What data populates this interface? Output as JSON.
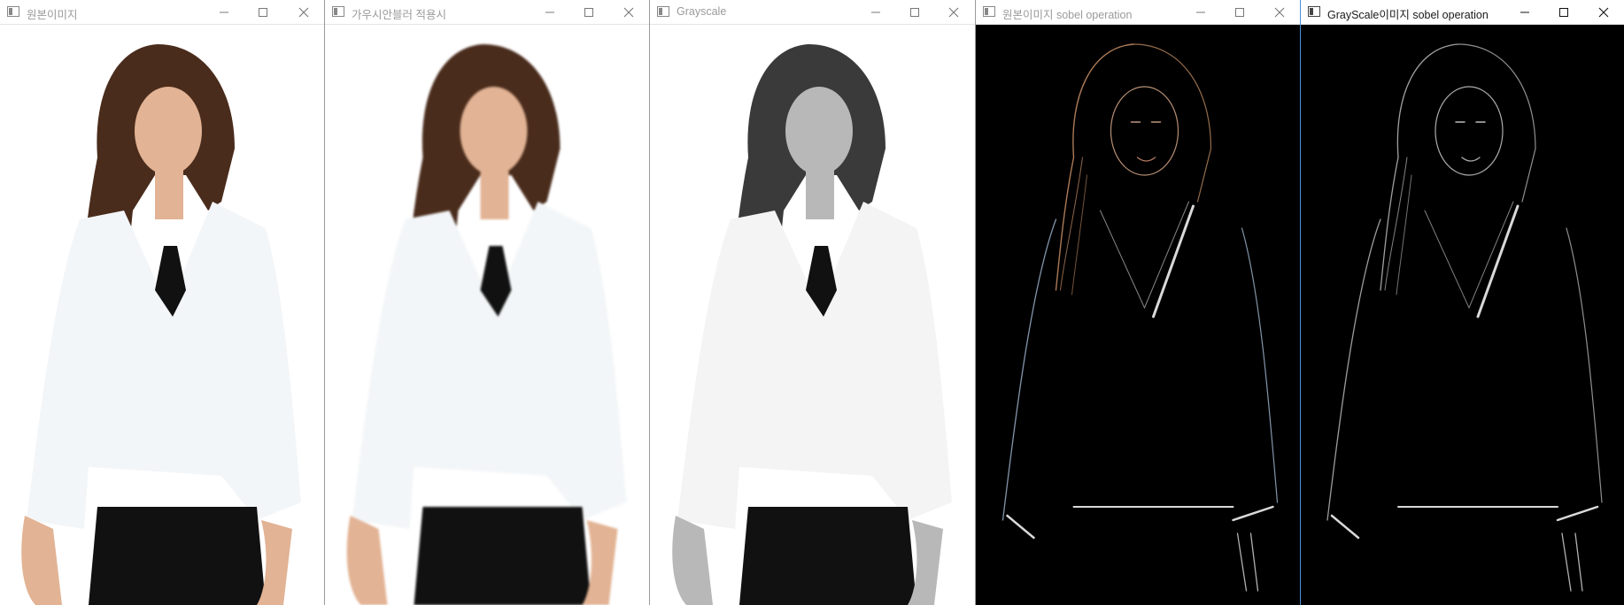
{
  "windows": [
    {
      "title": "원본이미지",
      "variant": "color"
    },
    {
      "title": "가우시안블러 적용시",
      "variant": "blur"
    },
    {
      "title": "Grayscale",
      "variant": "gray"
    },
    {
      "title": "원본이미지 sobel operation",
      "variant": "sobel-color"
    },
    {
      "title": "GrayScale이미지 sobel operation",
      "variant": "sobel-gray"
    }
  ],
  "controls": {
    "minimize": "minimize-icon",
    "maximize": "maximize-icon",
    "close": "close-icon"
  },
  "colors": {
    "hair": "#4a2c1c",
    "skin": "#e2b394",
    "blouse": "#f3f6f8",
    "black": "#111111",
    "gray_hair": "#3a3a3a",
    "gray_skin": "#b8b8b8",
    "edge_color": "#d0a080",
    "edge_gray": "#dddddd",
    "active_border": "#4a90d9"
  }
}
